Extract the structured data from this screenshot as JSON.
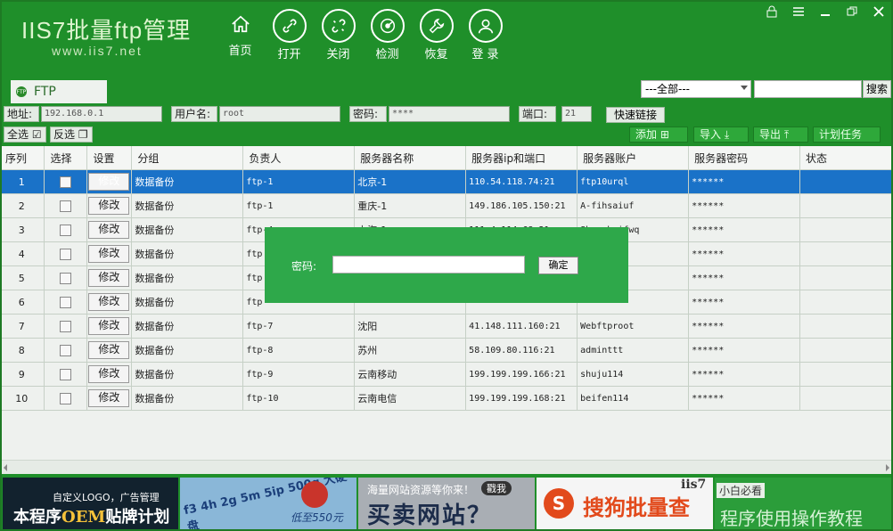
{
  "app": {
    "title": "IIS7批量ftp管理",
    "subtitle": "www.iis7.net"
  },
  "nav": [
    {
      "label": "首页",
      "icon": "home-icon"
    },
    {
      "label": "打开",
      "icon": "link-icon"
    },
    {
      "label": "关闭",
      "icon": "unlink-icon"
    },
    {
      "label": "检测",
      "icon": "detect-icon"
    },
    {
      "label": "恢复",
      "icon": "wrench-icon"
    },
    {
      "label": "登 录",
      "icon": "user-icon"
    }
  ],
  "window_controls": [
    "lock-icon",
    "menu-icon",
    "minimize-icon",
    "restore-icon",
    "close-icon"
  ],
  "tabs": {
    "ftp": "FTP"
  },
  "search": {
    "filter_value": "---全部---",
    "button": "搜索"
  },
  "connection": {
    "address_label": "地址:",
    "address_value": "192.168.0.1",
    "username_label": "用户名:",
    "username_value": "root",
    "password_label": "密码:",
    "password_value": "****",
    "port_label": "端口:",
    "port_value": "21",
    "quick_connect": "快速链接"
  },
  "toolbar": {
    "select_all": "全选",
    "invert": "反选",
    "add": "添加",
    "import": "导入",
    "export": "导出",
    "schedule": "计划任务"
  },
  "table": {
    "headers": [
      "序列",
      "选择",
      "设置",
      "分组",
      "负责人",
      "服务器名称",
      "服务器ip和端口",
      "服务器账户",
      "服务器密码",
      "状态"
    ],
    "edit_label": "修改",
    "rows": [
      {
        "no": "1",
        "group": "数据备份",
        "owner": "ftp-1",
        "name": "北京-1",
        "ip": "110.54.118.74:21",
        "account": "ftp10urql",
        "password": "******"
      },
      {
        "no": "2",
        "group": "数据备份",
        "owner": "ftp-1",
        "name": "重庆-1",
        "ip": "149.186.105.150:21",
        "account": "A-fihsaiuf",
        "password": "******"
      },
      {
        "no": "3",
        "group": "数据备份",
        "owner": "ftp-4",
        "name": "上海-1",
        "ip": "111.4.114.68:21",
        "account": "Shanghaifwq",
        "password": "******"
      },
      {
        "no": "4",
        "group": "数据备份",
        "owner": "ftp",
        "name": "",
        "ip": "",
        "account": "",
        "password": "******"
      },
      {
        "no": "5",
        "group": "数据备份",
        "owner": "ftp",
        "name": "",
        "ip": "",
        "account": "",
        "password": "******"
      },
      {
        "no": "6",
        "group": "数据备份",
        "owner": "ftp",
        "name": "",
        "ip": "",
        "account": "",
        "password": "******"
      },
      {
        "no": "7",
        "group": "数据备份",
        "owner": "ftp-7",
        "name": "沈阳",
        "ip": "41.148.111.160:21",
        "account": "Webftproot",
        "password": "******"
      },
      {
        "no": "8",
        "group": "数据备份",
        "owner": "ftp-8",
        "name": "苏州",
        "ip": "58.109.80.116:21",
        "account": "adminttt",
        "password": "******"
      },
      {
        "no": "9",
        "group": "数据备份",
        "owner": "ftp-9",
        "name": "云南移动",
        "ip": "199.199.199.166:21",
        "account": "shuju114",
        "password": "******"
      },
      {
        "no": "10",
        "group": "数据备份",
        "owner": "ftp-10",
        "name": "云南电信",
        "ip": "199.199.199.168:21",
        "account": "beifen114",
        "password": "******"
      }
    ]
  },
  "modal": {
    "label": "密码:",
    "confirm": "确定"
  },
  "banners": {
    "b1_small": "自定义LOGO，广告管理",
    "b1_big_prefix": "本程序",
    "b1_big_oem": "OEM",
    "b1_big_suffix": "贴牌计划",
    "b2_text": "f3 4h 2g 5m 5ip 500g 大硬盘",
    "b2_low": "低至550元",
    "b3_top": "海量网站资源等你来！",
    "b3_badge": "戳我",
    "b3_big": "买卖网站？",
    "b4_text": "搜狗批量查",
    "b4_brand": "iis7",
    "b5_tag": "小白必看",
    "b5_text": "程序使用操作教程"
  }
}
